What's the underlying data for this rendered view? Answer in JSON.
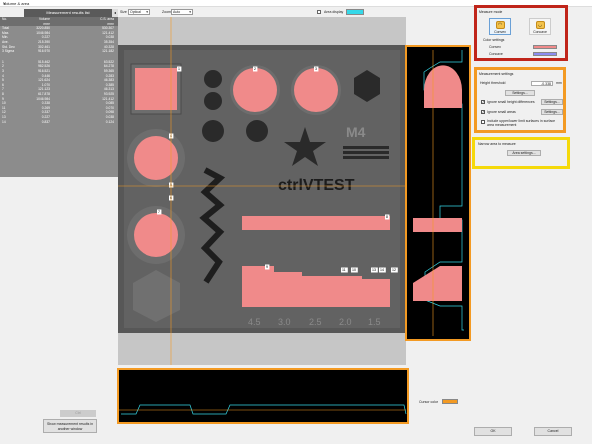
{
  "window": {
    "title": "Volume & area",
    "close": "✕"
  },
  "left_panel": {
    "header": "Measurement results list",
    "back": "◂",
    "columns": [
      "No.",
      "Volume",
      "C.S. area"
    ],
    "units": [
      "",
      "mm³",
      "mm²"
    ],
    "summary": [
      {
        "label": "Total",
        "volume": "3220.850",
        "area": "530.307"
      },
      {
        "label": "Max.",
        "volume": "1046.984",
        "area": "121.412"
      },
      {
        "label": "Min.",
        "volume": "0.227",
        "area": "0.038"
      },
      {
        "label": "Ave.",
        "volume": "215.390",
        "area": "35.354"
      },
      {
        "label": "Std. Dev.",
        "volume": "302.461",
        "area": "40.328"
      },
      {
        "label": "3 Sigma",
        "volume": "916.970",
        "area": "121.182"
      }
    ],
    "rows": [
      {
        "no": "1",
        "volume": "515.462",
        "area": "63.522"
      },
      {
        "no": "2",
        "volume": "982.526",
        "area": "64.278"
      },
      {
        "no": "3",
        "volume": "916.521",
        "area": "59.365"
      },
      {
        "no": "4",
        "volume": "0.446",
        "area": "0.283"
      },
      {
        "no": "5",
        "volume": "121.624",
        "area": "46.383"
      },
      {
        "no": "6",
        "volume": "1.070",
        "area": "0.385"
      },
      {
        "no": "7",
        "volume": "121.123",
        "area": "46.313"
      },
      {
        "no": "8",
        "volume": "617.878",
        "area": "93.925"
      },
      {
        "no": "9",
        "volume": "1046.984",
        "area": "121.412"
      },
      {
        "no": "10",
        "volume": "0.338",
        "area": "0.085"
      },
      {
        "no": "11",
        "volume": "0.269",
        "area": "0.070"
      },
      {
        "no": "12",
        "volume": "0.337",
        "area": "0.098"
      },
      {
        "no": "13",
        "volume": "0.227",
        "area": "0.038"
      },
      {
        "no": "14",
        "volume": "0.837",
        "area": "0.124"
      }
    ],
    "disabled_button": "Ctrl",
    "show_results_button": "Show measurement results in another window"
  },
  "toolbar": {
    "size_label": "Size",
    "size_value": "Optical",
    "zoom_label": "Zoom",
    "zoom_value": "Auto",
    "area_display_label": "Area display",
    "area_color": "#35d8e8"
  },
  "right_panel": {
    "measure_mode_title": "Measure mode",
    "convex_label": "Convex",
    "concave_label": "Concave",
    "color_settings_title": "Color settings",
    "convex_color_label": "Convex",
    "concave_color_label": "Concave",
    "convex_color": "#f08a8a",
    "concave_color": "#8c8cf0",
    "measurement_settings_title": "Measurement settings",
    "height_threshold_label": "Height threshold",
    "height_threshold_value": "-0.338",
    "height_threshold_unit": "mm",
    "settings_button": "Settings...",
    "ignore_height_label": "Ignore small height differences",
    "ignore_height_button": "Settings...",
    "ignore_areas_label": "Ignore small areas",
    "ignore_areas_button": "Settings...",
    "include_label": "Include upper/lower limit surfaces in surface area measurement",
    "narrow_title": "Narrow area to measure",
    "area_settings_button": "Area settings...",
    "cursor_color_label": "Cursor color",
    "cursor_color": "#f39a23",
    "ok_button": "OK",
    "cancel_button": "Cancel"
  },
  "plate": {
    "logo_text": "ctrlVTEST",
    "m4_text": "M4",
    "region_labels": [
      "1",
      "2",
      "3",
      "4",
      "5",
      "6",
      "7",
      "8",
      "9",
      "10",
      "11",
      "12",
      "13",
      "14"
    ],
    "step_labels": [
      "4.5",
      "3.0",
      "2.5",
      "2.0",
      "1.5"
    ]
  },
  "highlight_colors": {
    "red": "#c0251a",
    "orange": "#f39a23",
    "yellow": "#f5d90a"
  }
}
